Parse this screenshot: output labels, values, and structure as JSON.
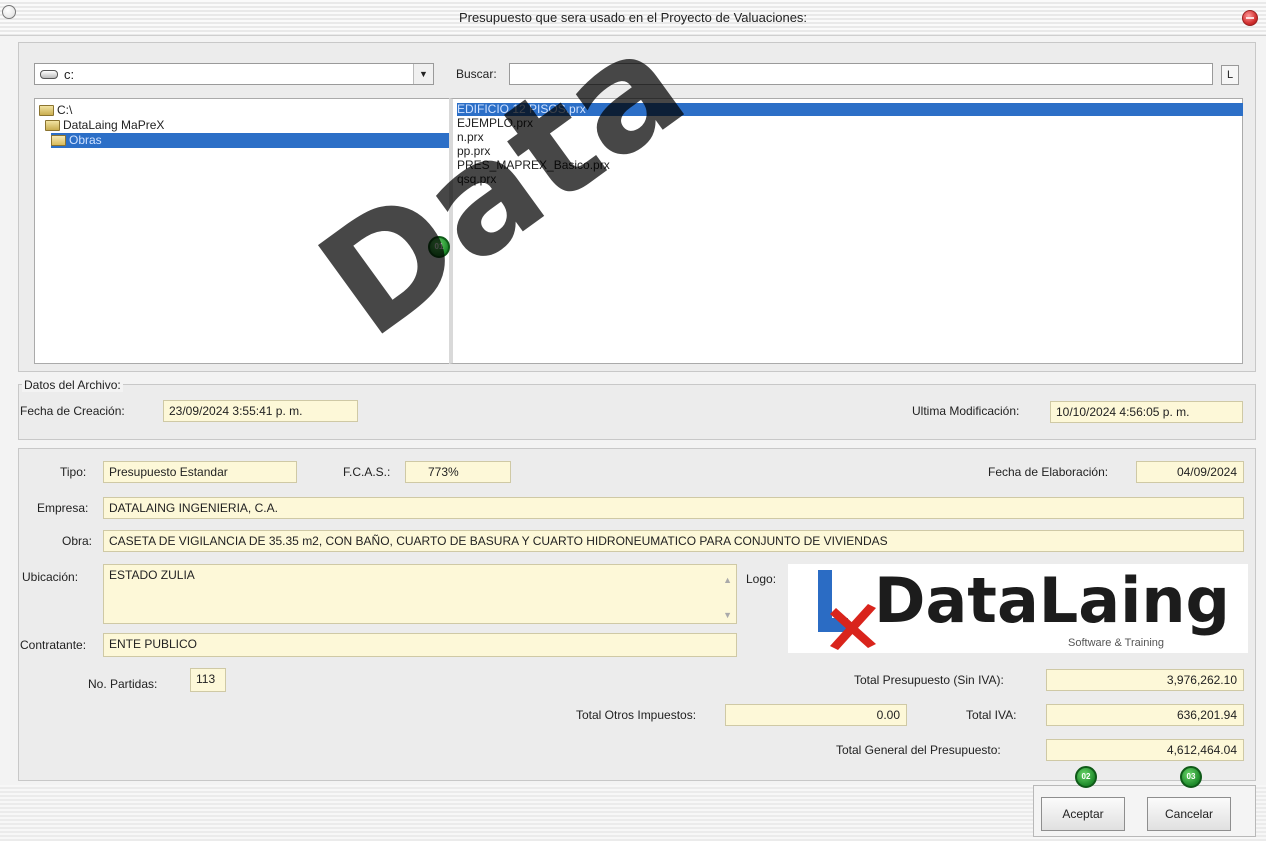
{
  "window": {
    "title": "Presupuesto que sera usado en el Proyecto de Valuaciones:"
  },
  "browser": {
    "drive": "c:",
    "search_label": "Buscar:",
    "search_value": "",
    "search_button": "L",
    "directories": [
      {
        "label": "C:\\"
      },
      {
        "label": "DataLaing MaPreX"
      },
      {
        "label": "Obras"
      }
    ],
    "files": [
      {
        "label": "EDIFICIO 12 PISOS.prx"
      },
      {
        "label": "EJEMPLO.prx"
      },
      {
        "label": "n.prx"
      },
      {
        "label": "pp.prx"
      },
      {
        "label": "PRES_MAPREX_Basico.prx"
      },
      {
        "label": "qsq.prx"
      }
    ],
    "selected_directory_index": 2,
    "selected_file_index": 0
  },
  "file_data": {
    "legend": "Datos del Archivo:",
    "created_label": "Fecha de Creación:",
    "created_value": "23/09/2024 3:55:41 p. m.",
    "modified_label": "Ultima Modificación:",
    "modified_value": "10/10/2024 4:56:05 p. m."
  },
  "details": {
    "tipo_label": "Tipo:",
    "tipo_value": "Presupuesto Estandar",
    "fcas_label": "F.C.A.S.:",
    "fcas_value": "773%",
    "fecha_label": "Fecha de Elaboración:",
    "fecha_value": "04/09/2024",
    "empresa_label": "Empresa:",
    "empresa_value": "DATALAING INGENIERIA, C.A.",
    "obra_label": "Obra:",
    "obra_value": "CASETA DE VIGILANCIA DE 35.35 m2, CON BAÑO, CUARTO DE BASURA Y CUARTO HIDRONEUMATICO PARA CONJUNTO DE VIVIENDAS",
    "ubicacion_label": "Ubicación:",
    "ubicacion_value": "ESTADO ZULIA",
    "logo_label": "Logo:",
    "logo_text": "DataLaing",
    "logo_sub": "Software & Training",
    "contratante_label": "Contratante:",
    "contratante_value": "ENTE PUBLICO",
    "partidas_label": "No. Partidas:",
    "partidas_value": "113",
    "total_sin_iva_label": "Total Presupuesto (Sin IVA):",
    "total_sin_iva_value": "3,976,262.10",
    "otros_label": "Total Otros Impuestos:",
    "otros_value": "0.00",
    "iva_label": "Total IVA:",
    "iva_value": "636,201.94",
    "general_label": "Total General del Presupuesto:",
    "general_value": "4,612,464.04"
  },
  "buttons": {
    "accept": "Aceptar",
    "cancel": "Cancelar"
  },
  "badges": [
    "01",
    "02",
    "03"
  ],
  "watermark": "Data",
  "colors": {
    "selection": "#2c6fc7",
    "field_bg": "#fdf8d8",
    "badge": "#1e8a2a"
  }
}
